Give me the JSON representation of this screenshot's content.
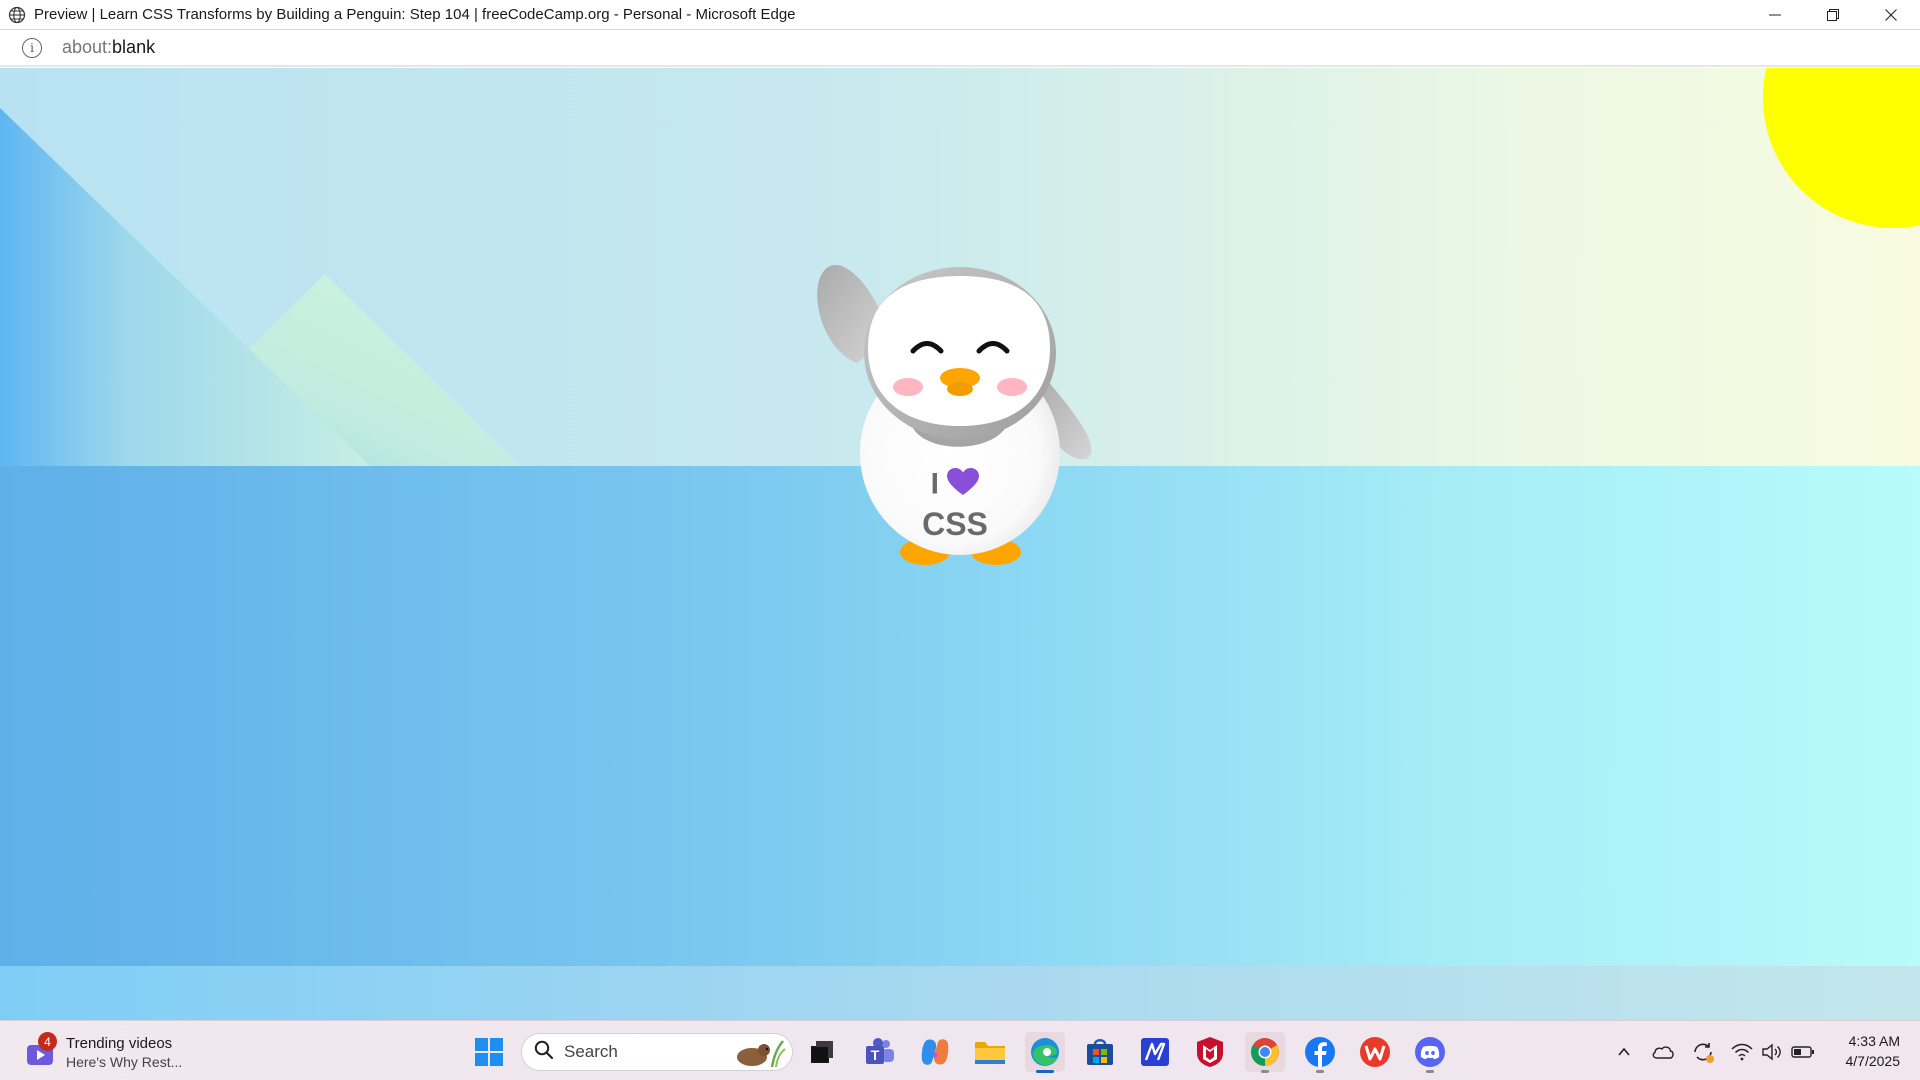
{
  "window": {
    "title": "Preview | Learn CSS Transforms by Building a Penguin: Step 104 | freeCodeCamp.org - Personal - Microsoft Edge",
    "controls": [
      "minimize-icon",
      "restore-icon",
      "close-icon"
    ]
  },
  "address_bar": {
    "scheme": "about:",
    "page": "blank"
  },
  "penguin": {
    "shirt_text_line1": "I",
    "shirt_text_line2": "CSS",
    "heart_emoji": "💜"
  },
  "colors": {
    "sun": "#ffff00",
    "sky_left": "#b8e2f2",
    "sky_right": "#f8fbe0",
    "ground_left": "#5fafe9",
    "ground_right": "#b8fbfb",
    "penguin_body": "#ffffff",
    "penguin_head": "#c0c0c0",
    "beak_feet": "#ffa500",
    "cheeks": "#ffb6c1",
    "heart": "#8a4fd8"
  },
  "taskbar": {
    "widget": {
      "badge": "4",
      "line1": "Trending videos",
      "line2": "Here's Why Rest..."
    },
    "search": {
      "label": "Search"
    },
    "apps": [
      "start-icon",
      "task-view-icon",
      "teams-icon",
      "copilot-icon",
      "file-explorer-icon",
      "edge-icon",
      "microsoft-store-icon",
      "app-icon",
      "mcafee-icon",
      "chrome-icon",
      "facebook-icon",
      "wps-office-icon",
      "discord-icon"
    ],
    "clock": {
      "time": "4:33 AM",
      "date": "4/7/2025"
    }
  }
}
